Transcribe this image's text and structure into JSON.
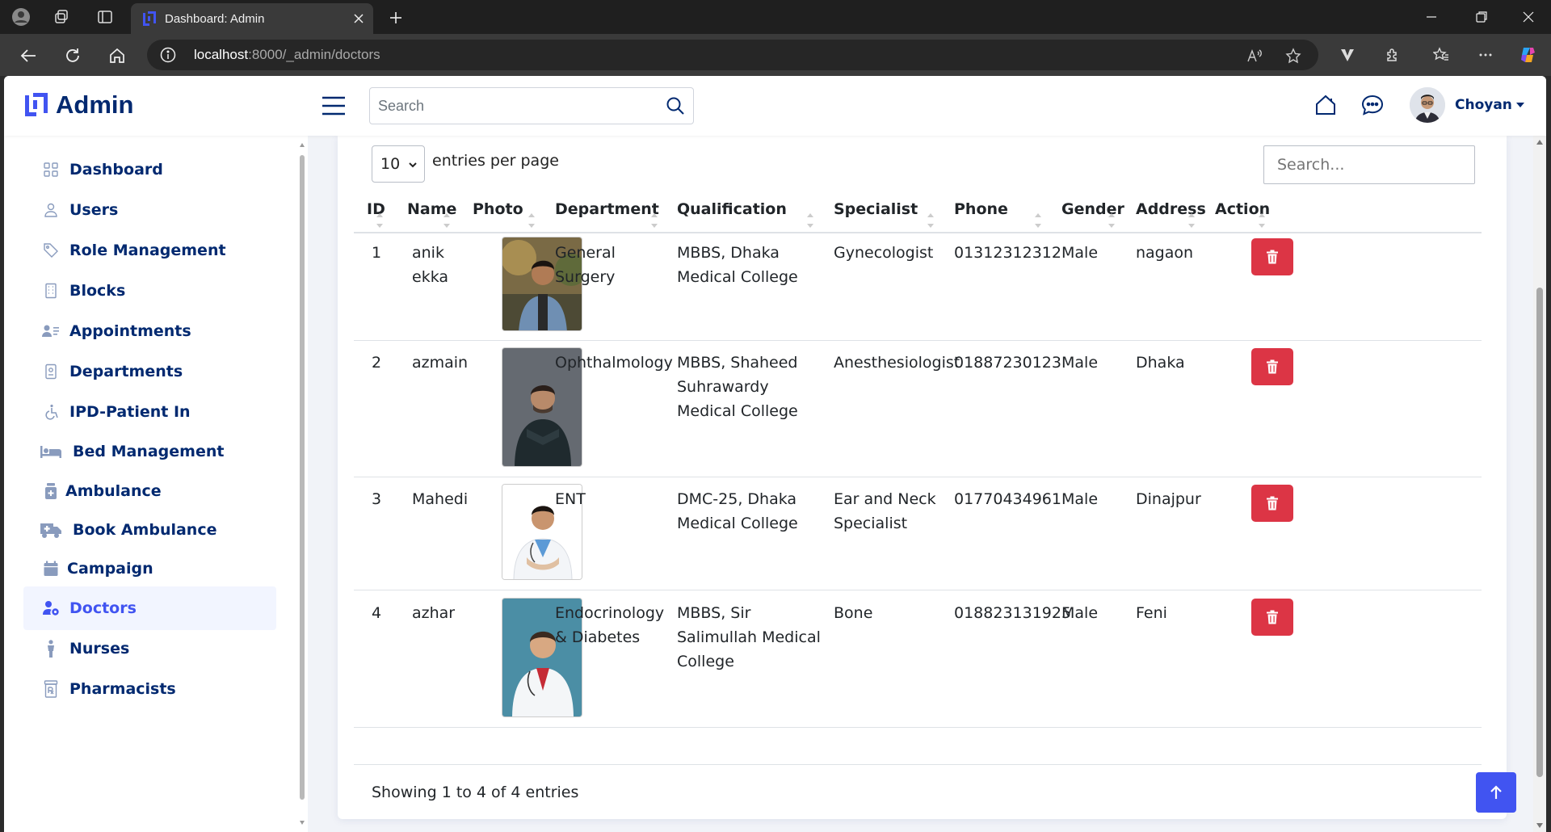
{
  "browser": {
    "tab_title": "Dashboard: Admin",
    "url_host": "localhost",
    "url_path": ":8000/_admin/doctors"
  },
  "topnav": {
    "logo_text": "Admin",
    "search_placeholder": "Search",
    "profile_name": "Choyan"
  },
  "sidebar": {
    "items": [
      {
        "label": "Dashboard",
        "icon": "grid-icon"
      },
      {
        "label": "Users",
        "icon": "person-icon"
      },
      {
        "label": "Role Management",
        "icon": "tag-icon"
      },
      {
        "label": "Blocks",
        "icon": "building-icon"
      },
      {
        "label": "Appointments",
        "icon": "person-lines-icon"
      },
      {
        "label": "Departments",
        "icon": "badge-icon"
      },
      {
        "label": "IPD-Patient In",
        "icon": "wheelchair-icon"
      },
      {
        "label": "Bed Management",
        "icon": "bed-icon"
      },
      {
        "label": "Ambulance",
        "icon": "medicine-bottle-icon"
      },
      {
        "label": "Book Ambulance",
        "icon": "ambulance-icon"
      },
      {
        "label": "Campaign",
        "icon": "calendar-icon"
      },
      {
        "label": "Doctors",
        "icon": "person-gear-icon"
      },
      {
        "label": "Nurses",
        "icon": "person-standing-icon"
      },
      {
        "label": "Pharmacists",
        "icon": "prescription-icon"
      }
    ],
    "active": "Doctors"
  },
  "table": {
    "length_value": "10",
    "length_label": "entries per page",
    "search_placeholder": "Search...",
    "columns": [
      "ID",
      "Name",
      "Photo",
      "Department",
      "Qualification",
      "Specialist",
      "Phone",
      "Gender",
      "Address",
      "Action"
    ],
    "rows": [
      {
        "id": "1",
        "name": "anik ekka",
        "department": "General Surgery",
        "qualification": "MBBS, Dhaka Medical College",
        "specialist": "Gynecologist",
        "phone": "01312312312",
        "gender": "Male",
        "address": "nagaon"
      },
      {
        "id": "2",
        "name": "azmain",
        "department": "Ophthalmology",
        "qualification": "MBBS, Shaheed Suhrawardy Medical College",
        "specialist": "Anesthesiologist",
        "phone": "01887230123",
        "gender": "Male",
        "address": "Dhaka"
      },
      {
        "id": "3",
        "name": "Mahedi",
        "department": "ENT",
        "qualification": "DMC-25, Dhaka Medical College",
        "specialist": "Ear and Neck Specialist",
        "phone": "01770434961",
        "gender": "Male",
        "address": "Dinajpur"
      },
      {
        "id": "4",
        "name": "azhar",
        "department": "Endocrinology & Diabetes",
        "qualification": "MBBS, Sir Salimullah Medical College",
        "specialist": "Bone",
        "phone": "018823131925",
        "gender": "Male",
        "address": "Feni"
      }
    ],
    "info": "Showing 1 to 4 of 4 entries"
  },
  "colors": {
    "brand": "#012970",
    "accent": "#4154f1",
    "danger": "#dc3545"
  }
}
